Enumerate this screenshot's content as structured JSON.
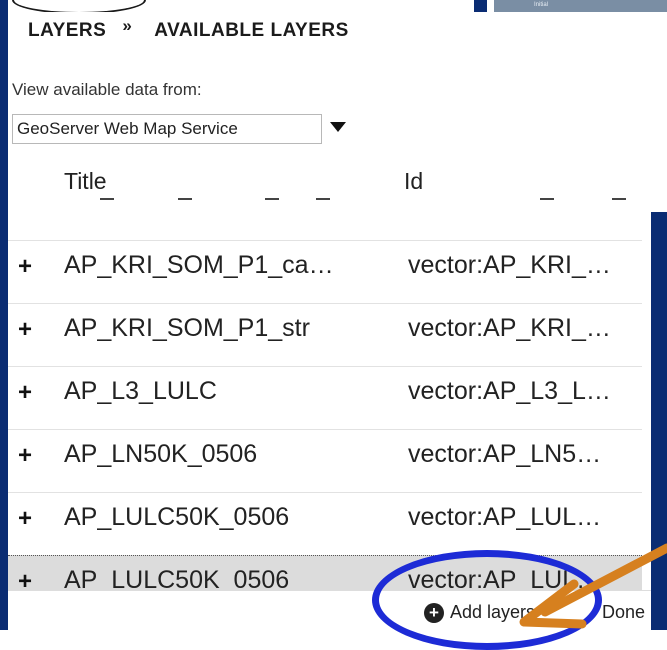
{
  "panel": {
    "breadcrumb": {
      "parent": "LAYERS",
      "separator": "»",
      "current": "AVAILABLE LAYERS"
    },
    "source": {
      "label": "View available data from:",
      "selected": "GeoServer Web Map Service"
    },
    "table": {
      "columns": [
        "Title",
        "Id"
      ],
      "rows": [
        {
          "title": "AP_KRI_SOM_P1_ca…",
          "id": "vector:AP_KRI_…",
          "selected": false
        },
        {
          "title": "AP_KRI_SOM_P1_str",
          "id": "vector:AP_KRI_…",
          "selected": false
        },
        {
          "title": "AP_L3_LULC",
          "id": "vector:AP_L3_L…",
          "selected": false
        },
        {
          "title": "AP_LN50K_0506",
          "id": "vector:AP_LN5…",
          "selected": false
        },
        {
          "title": "AP_LULC50K_0506",
          "id": "vector:AP_LUL…",
          "selected": false
        },
        {
          "title": "AP_LULC50K_0506",
          "id": "vector:AP_LUL…",
          "selected": true
        }
      ]
    },
    "footer": {
      "add_label": "Add layers",
      "done_label": "Done"
    }
  },
  "background_label": "Initial",
  "colors": {
    "frame": "#0a2c73",
    "annotation_circle": "#1d2bd6",
    "annotation_arrow": "#d6801f"
  },
  "icons": {
    "add": "plus-circle-icon",
    "expand": "plus-icon",
    "dropdown": "caret-down-icon"
  }
}
